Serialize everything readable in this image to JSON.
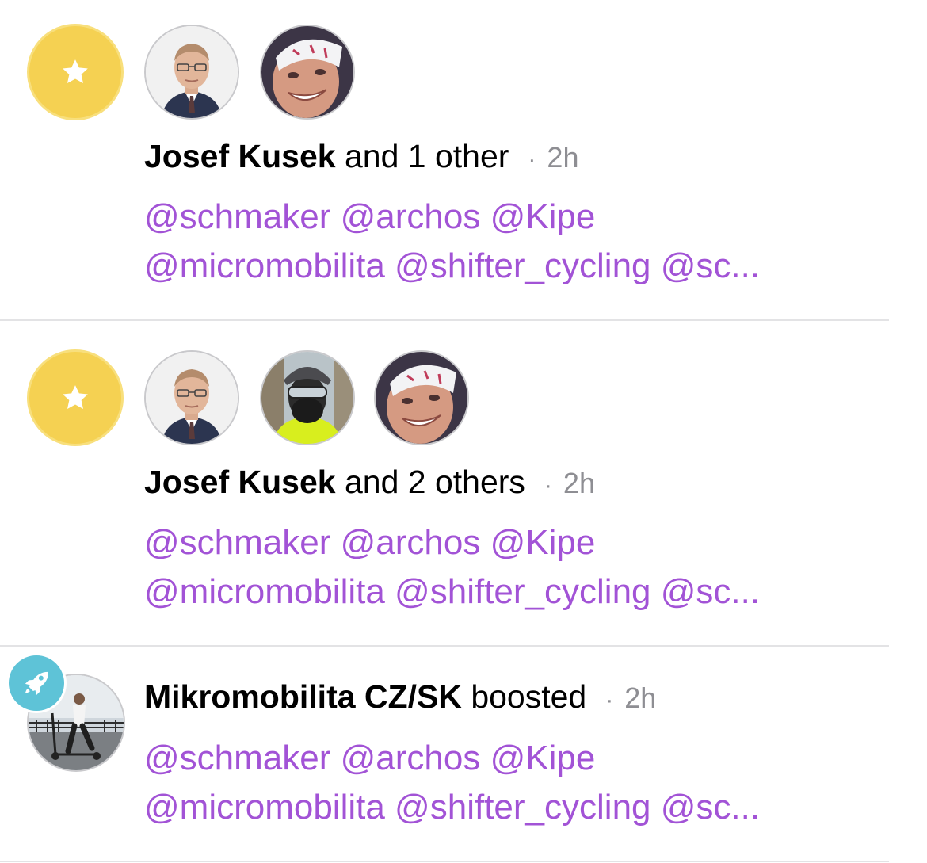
{
  "colors": {
    "accent_mention": "#a253d6",
    "favourite_badge": "#f5d152",
    "boost_badge": "#5ec3d7",
    "muted_text": "#8e8e93",
    "divider": "#e3e3e5"
  },
  "notifications": [
    {
      "type": "favourite",
      "icon": "star-icon",
      "avatars": [
        "avatar-josef-kusek",
        "avatar-user-bandana"
      ],
      "actor_name": "Josef Kusek",
      "actor_suffix": "and 1 other",
      "separator": "·",
      "time": "2h",
      "mentions_line1": "@schmaker @archos @Kipe",
      "mentions_line2": "@micromobilita @shifter_cycling @sc..."
    },
    {
      "type": "favourite",
      "icon": "star-icon",
      "avatars": [
        "avatar-josef-kusek",
        "avatar-cyclist-helmet",
        "avatar-user-bandana"
      ],
      "actor_name": "Josef Kusek",
      "actor_suffix": "and 2 others",
      "separator": "·",
      "time": "2h",
      "mentions_line1": "@schmaker @archos @Kipe",
      "mentions_line2": "@micromobilita @shifter_cycling @sc..."
    },
    {
      "type": "boost",
      "icon": "rocket-icon",
      "avatars": [
        "avatar-mikromobilita"
      ],
      "actor_name": "Mikromobilita CZ/SK",
      "actor_suffix": "boosted",
      "separator": "·",
      "time": "2h",
      "mentions_line1": "@schmaker @archos @Kipe",
      "mentions_line2": "@micromobilita @shifter_cycling @sc..."
    }
  ]
}
